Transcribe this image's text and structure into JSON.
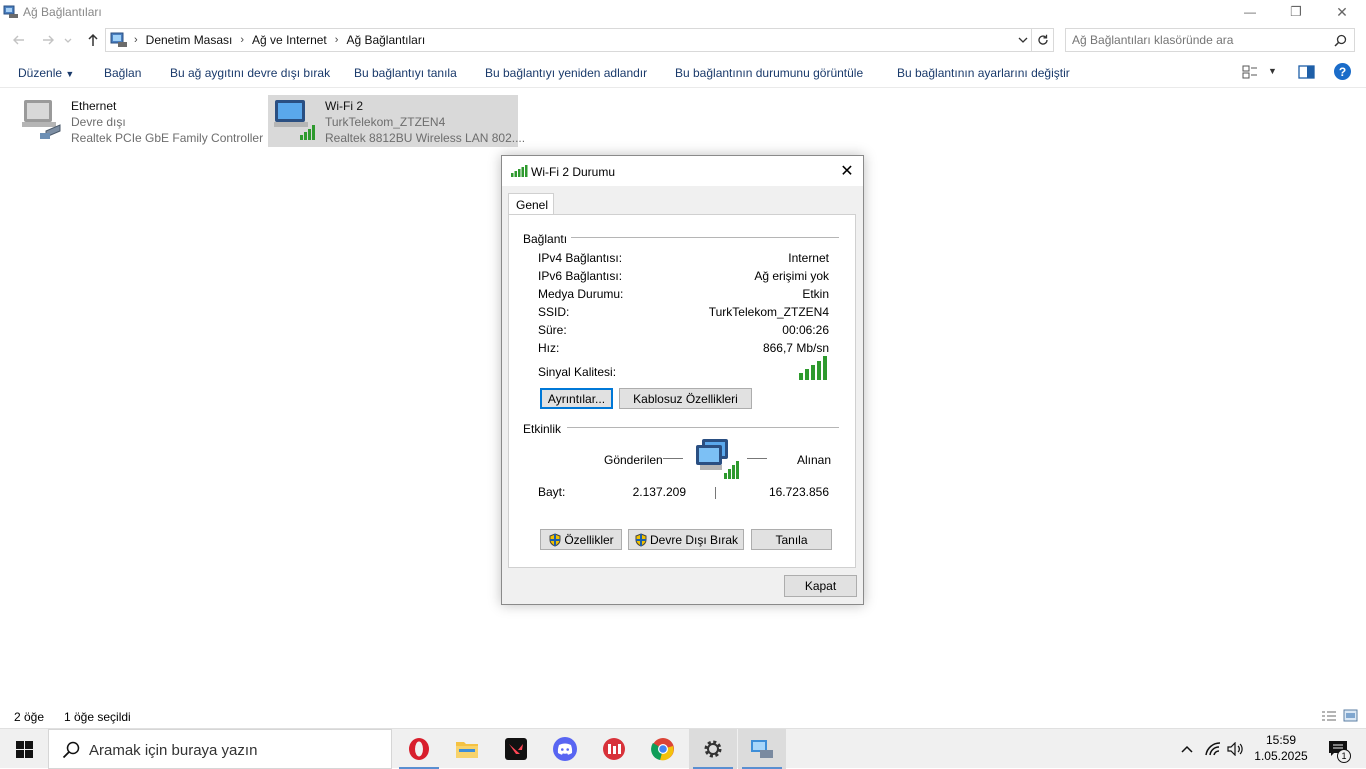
{
  "window": {
    "title": "Ağ Bağlantıları",
    "controls": {
      "minimize": "—",
      "maximize": "❐",
      "close": "✕"
    }
  },
  "address": {
    "root_arrow": "›",
    "crumbs": [
      "Denetim Masası",
      "Ağ ve Internet",
      "Ağ Bağlantıları"
    ],
    "search_placeholder": "Ağ Bağlantıları klasöründe ara"
  },
  "commands": {
    "organize": "Düzenle",
    "connect": "Bağlan",
    "disable": "Bu ağ aygıtını devre dışı bırak",
    "diagnose": "Bu bağlantıyı tanıla",
    "rename": "Bu bağlantıyı yeniden adlandır",
    "status": "Bu bağlantının durumunu görüntüle",
    "settings": "Bu bağlantının ayarlarını değiştir"
  },
  "items": [
    {
      "name": "Ethernet",
      "status": "Devre dışı",
      "device": "Realtek PCIe GbE Family Controller"
    },
    {
      "name": "Wi-Fi 2",
      "status": "TurkTelekom_ZTZEN4",
      "device": "Realtek 8812BU Wireless LAN 802...."
    }
  ],
  "statusbar": {
    "count": "2 öğe",
    "selected": "1 öğe seçildi"
  },
  "dialog": {
    "title": "Wi-Fi 2 Durumu",
    "tab": "Genel",
    "connection_group": "Bağlantı",
    "rows": [
      {
        "label": "IPv4 Bağlantısı:",
        "value": "Internet"
      },
      {
        "label": "IPv6 Bağlantısı:",
        "value": "Ağ erişimi yok"
      },
      {
        "label": "Medya Durumu:",
        "value": "Etkin"
      },
      {
        "label": "SSID:",
        "value": "TurkTelekom_ZTZEN4"
      },
      {
        "label": "Süre:",
        "value": "00:06:26"
      },
      {
        "label": "Hız:",
        "value": "866,7 Mb/sn"
      }
    ],
    "signal_label": "Sinyal Kalitesi:",
    "signal_bars": 5,
    "details_button": "Ayrıntılar...",
    "wireless_button": "Kablosuz Özellikleri",
    "activity_group": "Etkinlik",
    "sent_label": "Gönderilen",
    "received_label": "Alınan",
    "bytes_label": "Bayt:",
    "bytes_sent": "2.137.209",
    "bytes_received": "16.723.856",
    "properties_button": "Özellikler",
    "disable_button": "Devre Dışı Bırak",
    "diagnose_button": "Tanıla",
    "close_button": "Kapat"
  },
  "taskbar": {
    "search_text": "Aramak için buraya yazın",
    "time": "15:59",
    "date": "1.05.2025",
    "notification_count": "1"
  },
  "colors": {
    "accent": "#0078d7",
    "command_text": "#1a3a6b",
    "selection": "#d9d9d9",
    "signal": "#2e9a2e"
  }
}
